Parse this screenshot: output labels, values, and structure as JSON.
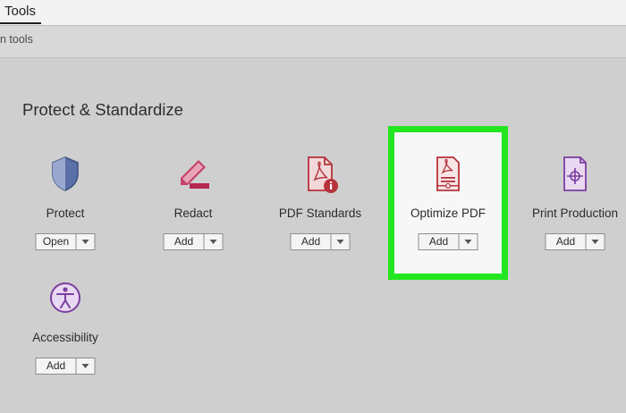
{
  "topbar": {
    "tab_label": "Tools"
  },
  "subbar": {
    "search_text": "n tools"
  },
  "section": {
    "title": "Protect & Standardize"
  },
  "tools": [
    {
      "label": "Protect",
      "button": "Open",
      "icon": "shield-icon"
    },
    {
      "label": "Redact",
      "button": "Add",
      "icon": "redact-marker-icon"
    },
    {
      "label": "PDF Standards",
      "button": "Add",
      "icon": "pdf-standards-icon"
    },
    {
      "label": "Optimize PDF",
      "button": "Add",
      "icon": "optimize-pdf-icon"
    },
    {
      "label": "Print Production",
      "button": "Add",
      "icon": "print-production-icon"
    },
    {
      "label": "Accessibility",
      "button": "Add",
      "icon": "accessibility-icon"
    }
  ],
  "colors": {
    "highlight": "#22e61e",
    "accent_red": "#b5323a",
    "accent_purple": "#7a3ea0",
    "shield_blue": "#5b6fa8"
  }
}
